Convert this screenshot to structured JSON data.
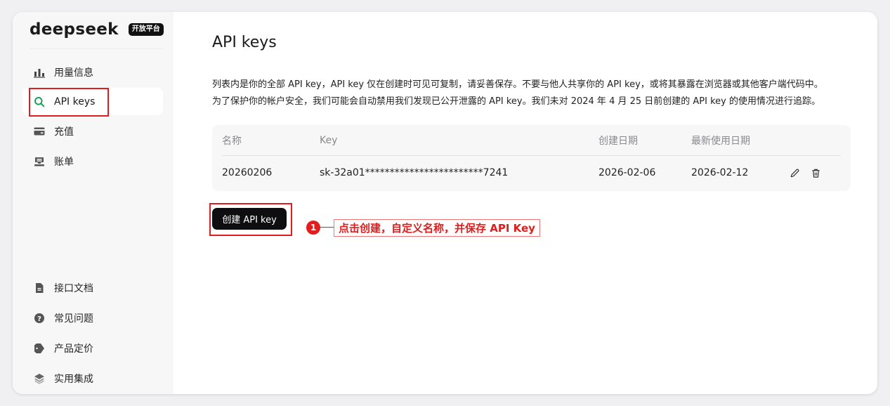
{
  "brand": {
    "name": "deepseek",
    "badge": "开放平台"
  },
  "sidebar": {
    "items": [
      {
        "label": "用量信息",
        "icon": "bar-chart-icon"
      },
      {
        "label": "API keys",
        "icon": "search-icon"
      },
      {
        "label": "充值",
        "icon": "card-icon"
      },
      {
        "label": "账单",
        "icon": "inbox-icon"
      },
      {
        "label": "接口文档",
        "icon": "document-icon"
      },
      {
        "label": "常见问题",
        "icon": "question-icon"
      },
      {
        "label": "产品定价",
        "icon": "tag-icon"
      },
      {
        "label": "实用集成",
        "icon": "layers-icon"
      }
    ],
    "active_item": "API keys"
  },
  "main": {
    "title": "API keys",
    "description_line1": "列表内是你的全部 API key，API key 仅在创建时可见可复制，请妥善保存。不要与他人共享你的 API key，或将其暴露在浏览器或其他客户端代码中。",
    "description_line2": "为了保护你的帐户安全，我们可能会自动禁用我们发现已公开泄露的 API key。我们未对 2024 年 4 月 25 日前创建的 API key 的使用情况进行追踪。",
    "table": {
      "headers": [
        "名称",
        "Key",
        "创建日期",
        "最新使用日期"
      ],
      "rows": [
        {
          "name": "20260206",
          "key": "sk-32a01************************7241",
          "created": "2026-02-06",
          "last_used": "2026-02-12"
        }
      ]
    },
    "create_button": "创建 API key"
  },
  "annotation": {
    "number": "1",
    "text": "点击创建，自定义名称，并保存 API Key",
    "color": "#e11d1d"
  },
  "colors": {
    "accent_green": "#1a9e55",
    "highlight_red": "#e11d1d",
    "button_black": "#0e0e10"
  }
}
